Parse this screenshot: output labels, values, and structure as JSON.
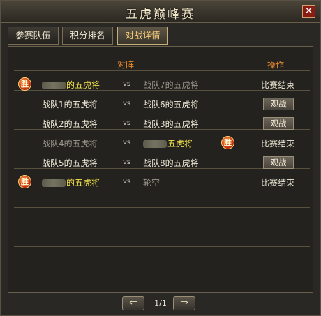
{
  "window": {
    "title": "五虎巅峰赛",
    "close_label": "✕"
  },
  "tabs": [
    {
      "label": "参赛队伍",
      "active": false
    },
    {
      "label": "积分排名",
      "active": false
    },
    {
      "label": "对战详情",
      "active": true
    }
  ],
  "table": {
    "header_matchup": "对阵",
    "header_action": "操作",
    "vs_label": "vs",
    "rows": [
      {
        "left": "的五虎将",
        "right": "战队7的五虎将",
        "action": "比赛结束",
        "winner": "left"
      },
      {
        "left": "战队1的五虎将",
        "right": "战队6的五虎将",
        "action": "观战",
        "winner": ""
      },
      {
        "left": "战队2的五虎将",
        "right": "战队3的五虎将",
        "action": "观战",
        "winner": ""
      },
      {
        "left": "战队4的五虎将",
        "right": "五虎将",
        "action": "比赛结束",
        "winner": "right"
      },
      {
        "left": "战队5的五虎将",
        "right": "战队8的五虎将",
        "action": "观战",
        "winner": ""
      },
      {
        "left": "的五虎将",
        "right": "轮空",
        "action": "比赛结束",
        "winner": "left"
      }
    ]
  },
  "badges": {
    "win_label": "胜"
  },
  "pager": {
    "prev_icon": "⇐",
    "next_icon": "⇒",
    "page": "1/1"
  }
}
